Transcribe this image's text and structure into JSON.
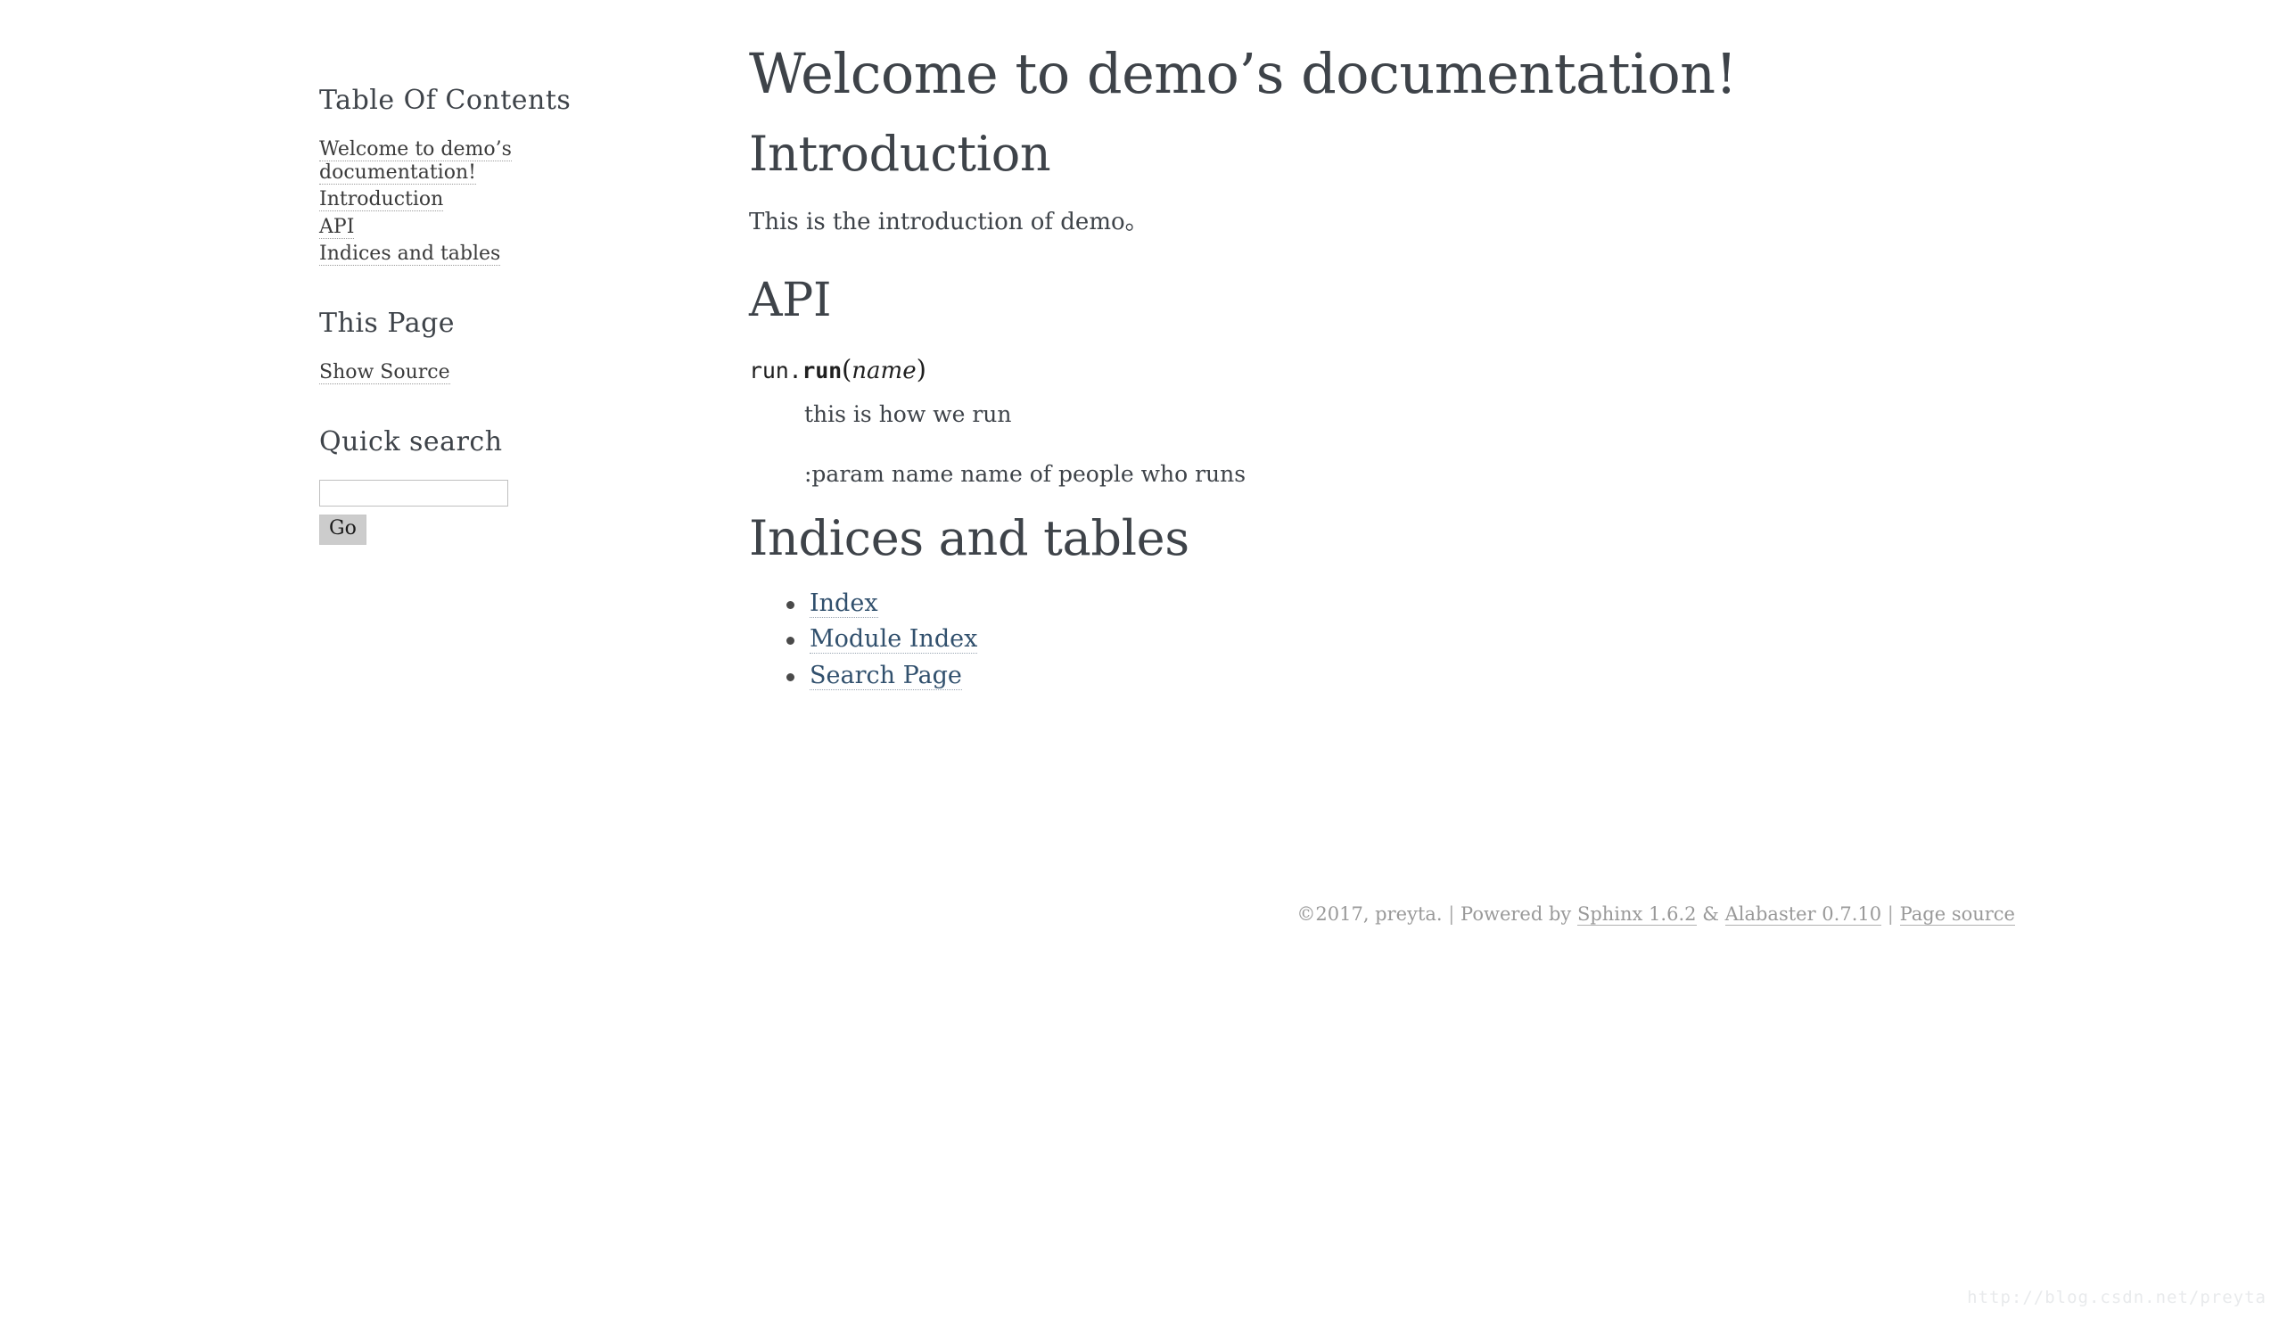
{
  "sidebar": {
    "toc": {
      "heading": "Table Of Contents",
      "items": [
        {
          "label": "Welcome to demo’s documentation!"
        },
        {
          "label": "Introduction"
        },
        {
          "label": "API"
        },
        {
          "label": "Indices and tables"
        }
      ]
    },
    "this_page": {
      "heading": "This Page",
      "show_source_label": "Show Source"
    },
    "quick_search": {
      "heading": "Quick search",
      "input_value": "",
      "input_placeholder": "",
      "go_label": "Go"
    }
  },
  "main": {
    "title": "Welcome to demo’s documentation!",
    "introduction": {
      "heading": "Introduction",
      "paragraph": "This is the introduction of demo。"
    },
    "api": {
      "heading": "API",
      "signature": {
        "prename": "run.",
        "name": "run",
        "open_paren": "(",
        "param": "name",
        "close_paren": ")"
      },
      "description": "this is how we run",
      "param_line": ":param name name of people who runs"
    },
    "indices": {
      "heading": "Indices and tables",
      "items": [
        {
          "label": "Index"
        },
        {
          "label": "Module Index"
        },
        {
          "label": "Search Page"
        }
      ]
    }
  },
  "footer": {
    "copyright": "©2017, preyta.",
    "separator": "|",
    "powered_by": "Powered by",
    "sphinx": "Sphinx 1.6.2",
    "ampersand": "&",
    "alabaster": "Alabaster 0.7.10",
    "page_source": "Page source"
  },
  "watermark": {
    "text": "http://blog.csdn.net/preyta"
  },
  "colors": {
    "text": "#3e4349",
    "sidebar_link": "#3b3b3b",
    "body_link": "#31506d",
    "footer_text": "#999999",
    "button_bg": "#cccccc",
    "background": "#ffffff"
  }
}
